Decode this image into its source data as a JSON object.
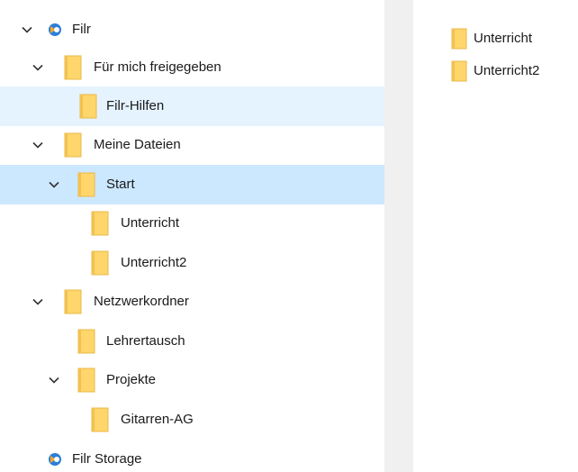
{
  "navigation_tree": {
    "items": [
      {
        "label": "Filr",
        "icon": "filr-icon",
        "expanded": true,
        "state": "normal"
      },
      {
        "label": "Für mich freigegeben",
        "icon": "folder-icon",
        "expanded": true,
        "state": "normal"
      },
      {
        "label": "Filr-Hilfen",
        "icon": "folder-icon",
        "expanded": null,
        "state": "hover"
      },
      {
        "label": "Meine Dateien",
        "icon": "folder-icon",
        "expanded": true,
        "state": "normal"
      },
      {
        "label": "Start",
        "icon": "folder-icon",
        "expanded": true,
        "state": "selected"
      },
      {
        "label": "Unterricht",
        "icon": "folder-icon",
        "expanded": null,
        "state": "normal"
      },
      {
        "label": "Unterricht2",
        "icon": "folder-icon",
        "expanded": null,
        "state": "normal"
      },
      {
        "label": "Netzwerkordner",
        "icon": "folder-icon",
        "expanded": true,
        "state": "normal"
      },
      {
        "label": "Lehrertausch",
        "icon": "folder-icon",
        "expanded": null,
        "state": "normal"
      },
      {
        "label": "Projekte",
        "icon": "folder-icon",
        "expanded": true,
        "state": "normal"
      },
      {
        "label": "Gitarren-AG",
        "icon": "folder-icon",
        "expanded": null,
        "state": "normal"
      },
      {
        "label": "Filr Storage",
        "icon": "filr-storage-icon",
        "expanded": null,
        "state": "normal"
      }
    ]
  },
  "content_pane": {
    "items": [
      {
        "label": "Unterricht",
        "icon": "folder-icon"
      },
      {
        "label": "Unterricht2",
        "icon": "folder-icon"
      }
    ]
  },
  "colors": {
    "selected_row": "#cce8ff",
    "hover_row": "#e5f3ff",
    "folder_fill": "#ffd66b",
    "folder_edge": "#e8b84a",
    "filr_blue": "#2b7fd8",
    "filr_orange": "#f5a623",
    "splitter": "#f0f0f0"
  }
}
